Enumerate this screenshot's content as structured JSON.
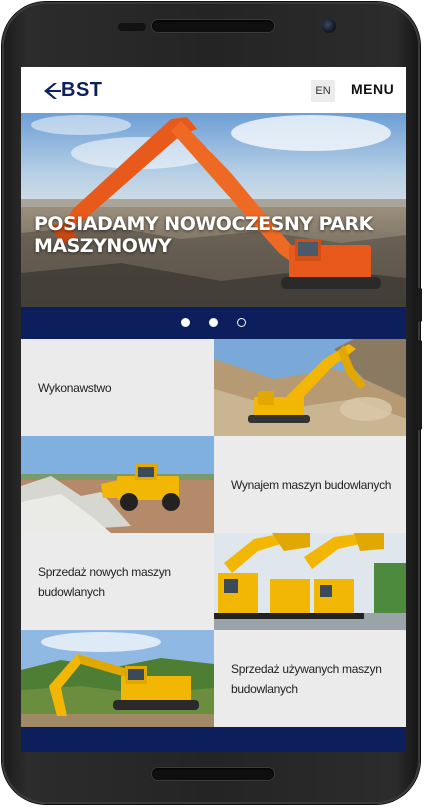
{
  "header": {
    "logo_text": "BST",
    "lang_label": "EN",
    "menu_label": "MENU"
  },
  "hero": {
    "title": "POSIADAMY NOWOCZESNY PARK MASZYNOWY",
    "slides_total": 3,
    "active_slide": 1
  },
  "tiles": [
    {
      "label": "Wykonawstwo"
    },
    {
      "label": "Wynajem maszyn budowlanych"
    },
    {
      "label": "Sprzedaż nowych maszyn budowlanych"
    },
    {
      "label": "Sprzedaż używanych maszyn budowlanych"
    }
  ],
  "colors": {
    "brand_navy": "#0c1f5c",
    "tile_bg": "#ebebeb",
    "machine_orange": "#e85a1c",
    "machine_yellow": "#f2b705"
  }
}
